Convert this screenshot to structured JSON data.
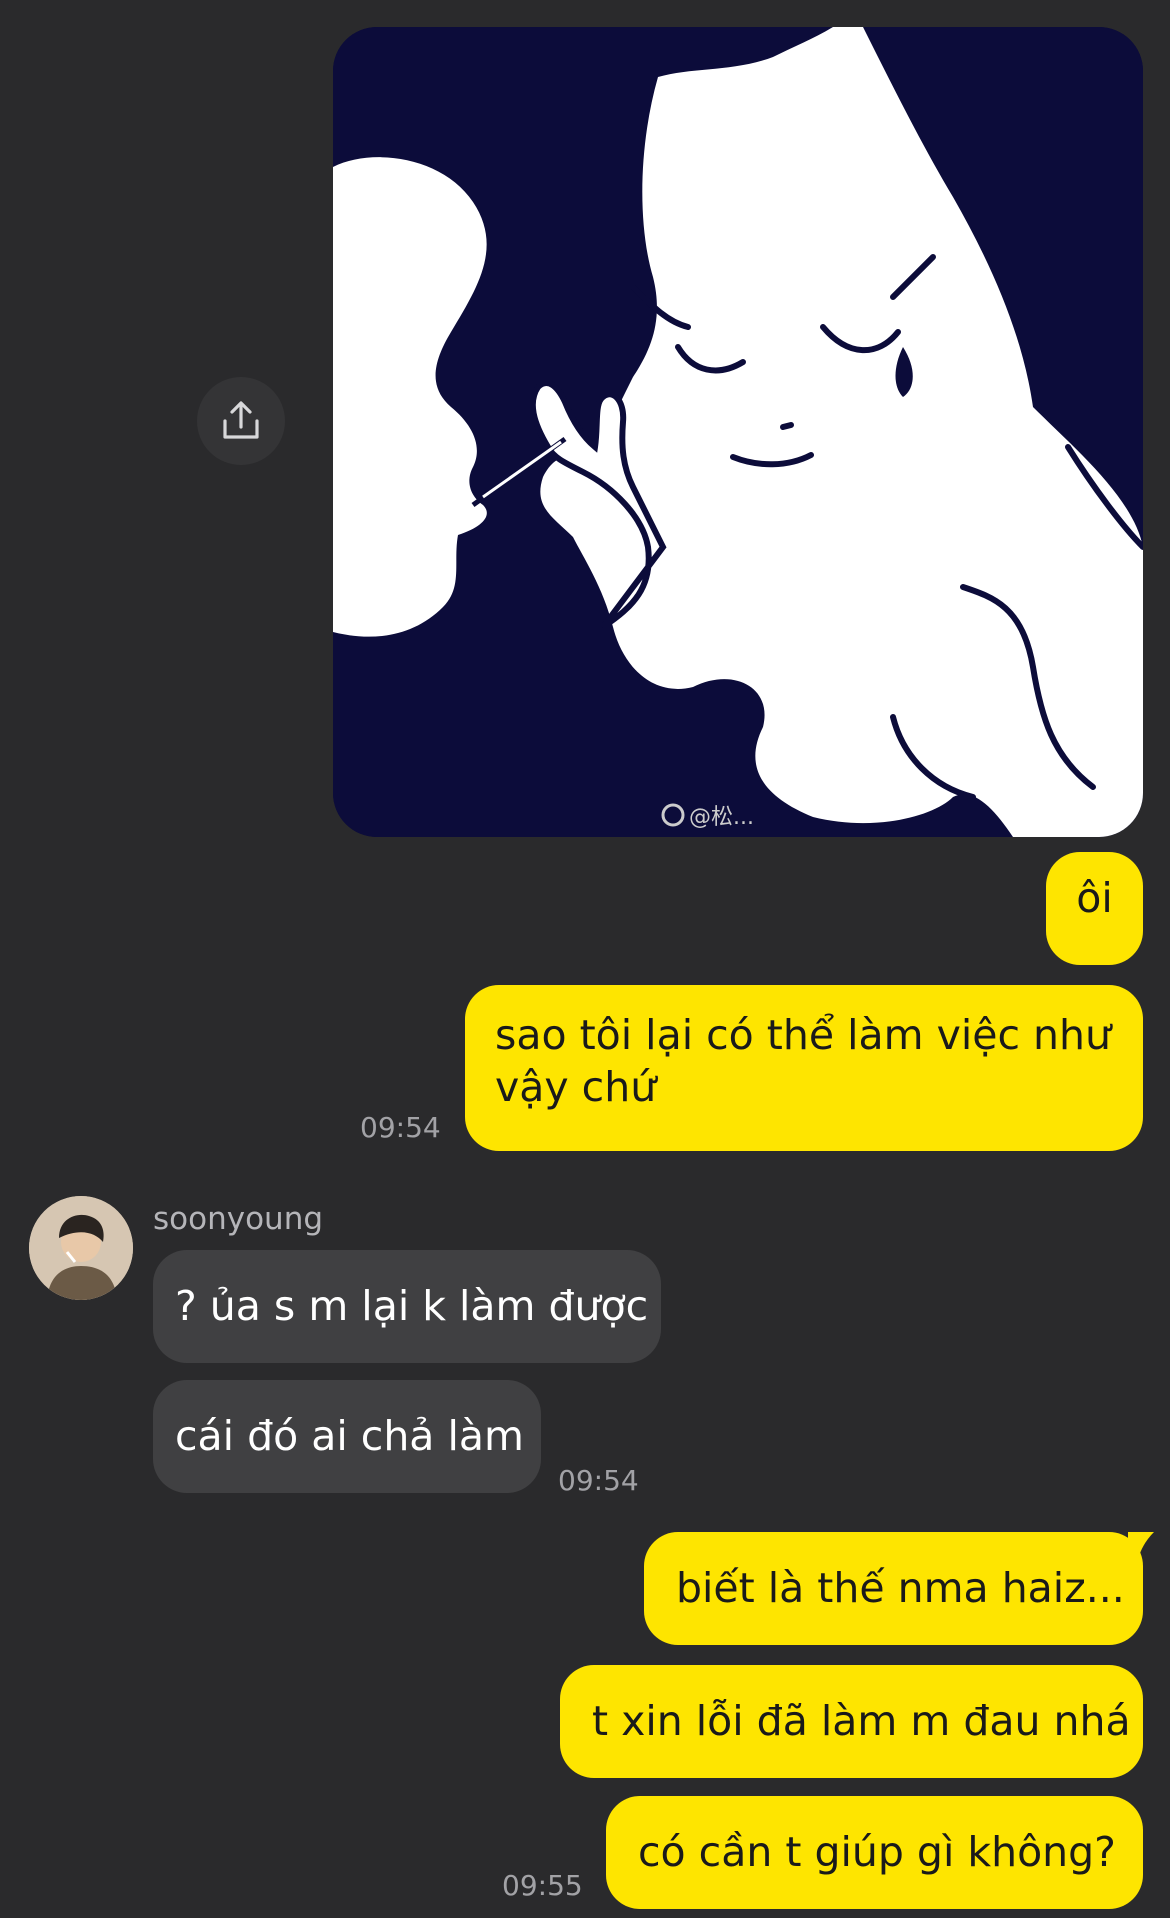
{
  "image_message": {
    "watermark": "@松..."
  },
  "share": {
    "icon": "share-icon"
  },
  "outgoing_1": {
    "bubbles": [
      "ôi",
      "sao tôi lại có thể làm việc như",
      "vậy chứ"
    ],
    "time": "09:54"
  },
  "incoming": {
    "sender": "soonyoung",
    "bubbles": [
      "? ủa s m lại k làm được",
      "cái đó ai chả làm"
    ],
    "time": "09:54"
  },
  "outgoing_2": {
    "bubbles": [
      "biết là thế nma haiz...",
      "t xin lỗi đã làm m đau nhá",
      "có cần t giúp gì không?"
    ],
    "time": "09:55"
  },
  "colors": {
    "background": "#2a2a2c",
    "outgoing_bubble": "#fee500",
    "incoming_bubble": "#404042",
    "timestamp": "#a2a2a6"
  }
}
